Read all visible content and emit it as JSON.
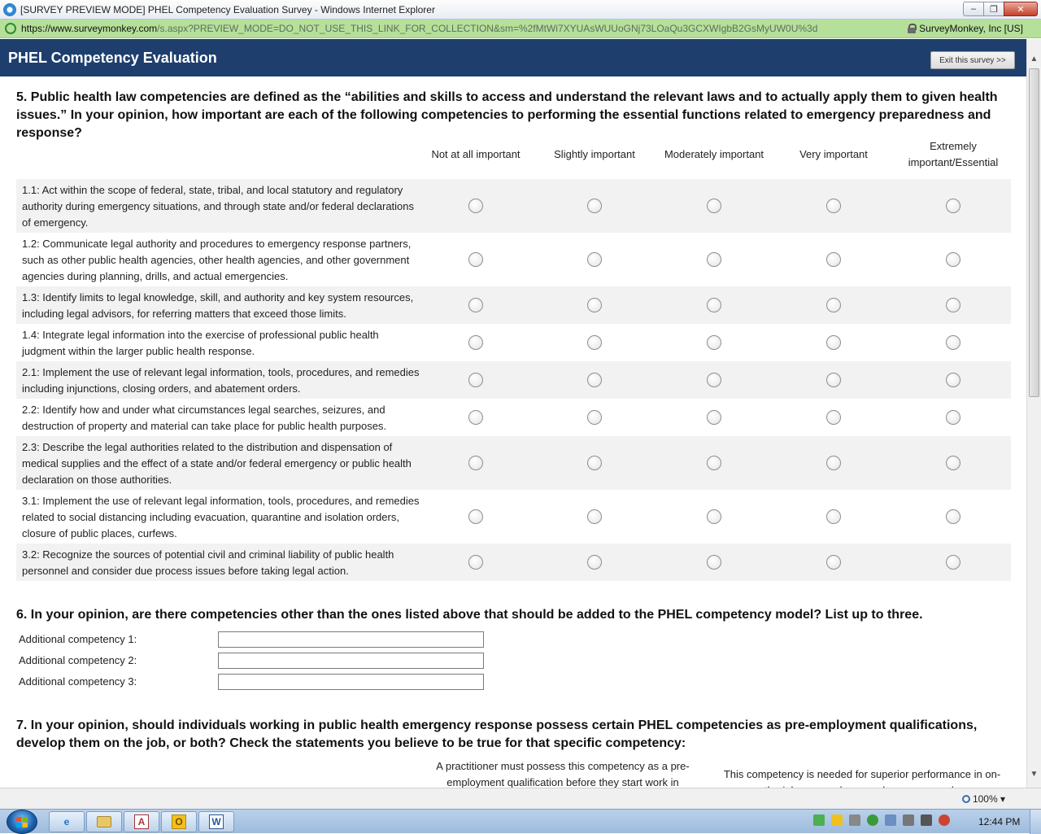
{
  "window": {
    "title": "[SURVEY PREVIEW MODE] PHEL Competency Evaluation Survey - Windows Internet Explorer",
    "url_host": "https://www.surveymonkey.com",
    "url_path": "/s.aspx?PREVIEW_MODE=DO_NOT_USE_THIS_LINK_FOR_COLLECTION&sm=%2fMtWi7XYUAsWUUoGNj73LOaQu3GCXWIgbB2GsMyUW0U%3d",
    "cert": "SurveyMonkey, Inc [US]"
  },
  "survey": {
    "title": "PHEL Competency Evaluation",
    "exit_label": "Exit this survey >>"
  },
  "q5": {
    "text": "5. Public health law competencies are defined as the “abilities and skills to access and understand the relevant laws and to actually apply them to given health issues.” In your opinion, how important are each of the following competencies to performing the essential functions related to emergency preparedness and response?",
    "columns": [
      "Not at all important",
      "Slightly important",
      "Moderately important",
      "Very important",
      "Extremely important/Essential"
    ],
    "rows": [
      "1.1: Act within the scope of federal, state, tribal, and local statutory and regulatory authority during emergency situations, and through state and/or federal declarations of emergency.",
      "1.2: Communicate legal authority and procedures to emergency response partners, such as other public health agencies, other health agencies, and other government agencies during planning, drills, and actual emergencies.",
      "1.3: Identify limits to legal knowledge, skill, and authority and key system resources, including legal advisors, for referring matters that exceed those limits.",
      "1.4: Integrate legal information into the exercise of professional public health judgment within the larger public health response.",
      "2.1: Implement the use of relevant legal information, tools, procedures, and remedies including injunctions, closing orders, and abatement orders.",
      "2.2: Identify how and under what circumstances legal searches, seizures, and destruction of property and material can take place for public health purposes.",
      "2.3: Describe the legal authorities related to the distribution and dispensation of medical supplies and the effect of a state and/or federal emergency or public health declaration on those authorities.",
      "3.1: Implement the use of relevant legal information, tools, procedures, and remedies related to social distancing including evacuation, quarantine and isolation orders, closure of public places, curfews.",
      "3.2: Recognize the sources of potential civil and criminal liability of public health personnel and consider due process issues before taking legal action."
    ]
  },
  "q6": {
    "text": "6. In your opinion, are there competencies other than the ones listed above that should be added to the PHEL competency model? List up to three.",
    "fields": [
      "Additional competency 1:",
      "Additional competency 2:",
      "Additional competency 3:"
    ]
  },
  "q7": {
    "text": "7. In your opinion, should individuals working in public health emergency response possess certain PHEL competencies as pre-employment qualifications, develop them on the job, or both? Check the statements you believe to be true for that specific competency:",
    "col1": "A practitioner must possess this competency as a pre-employment qualification before they start work in",
    "col2": "This competency is needed for superior performance in on-the-job preparedness and response work."
  },
  "status": {
    "zoom": "100%"
  },
  "taskbar": {
    "clock": "12:44 PM"
  }
}
